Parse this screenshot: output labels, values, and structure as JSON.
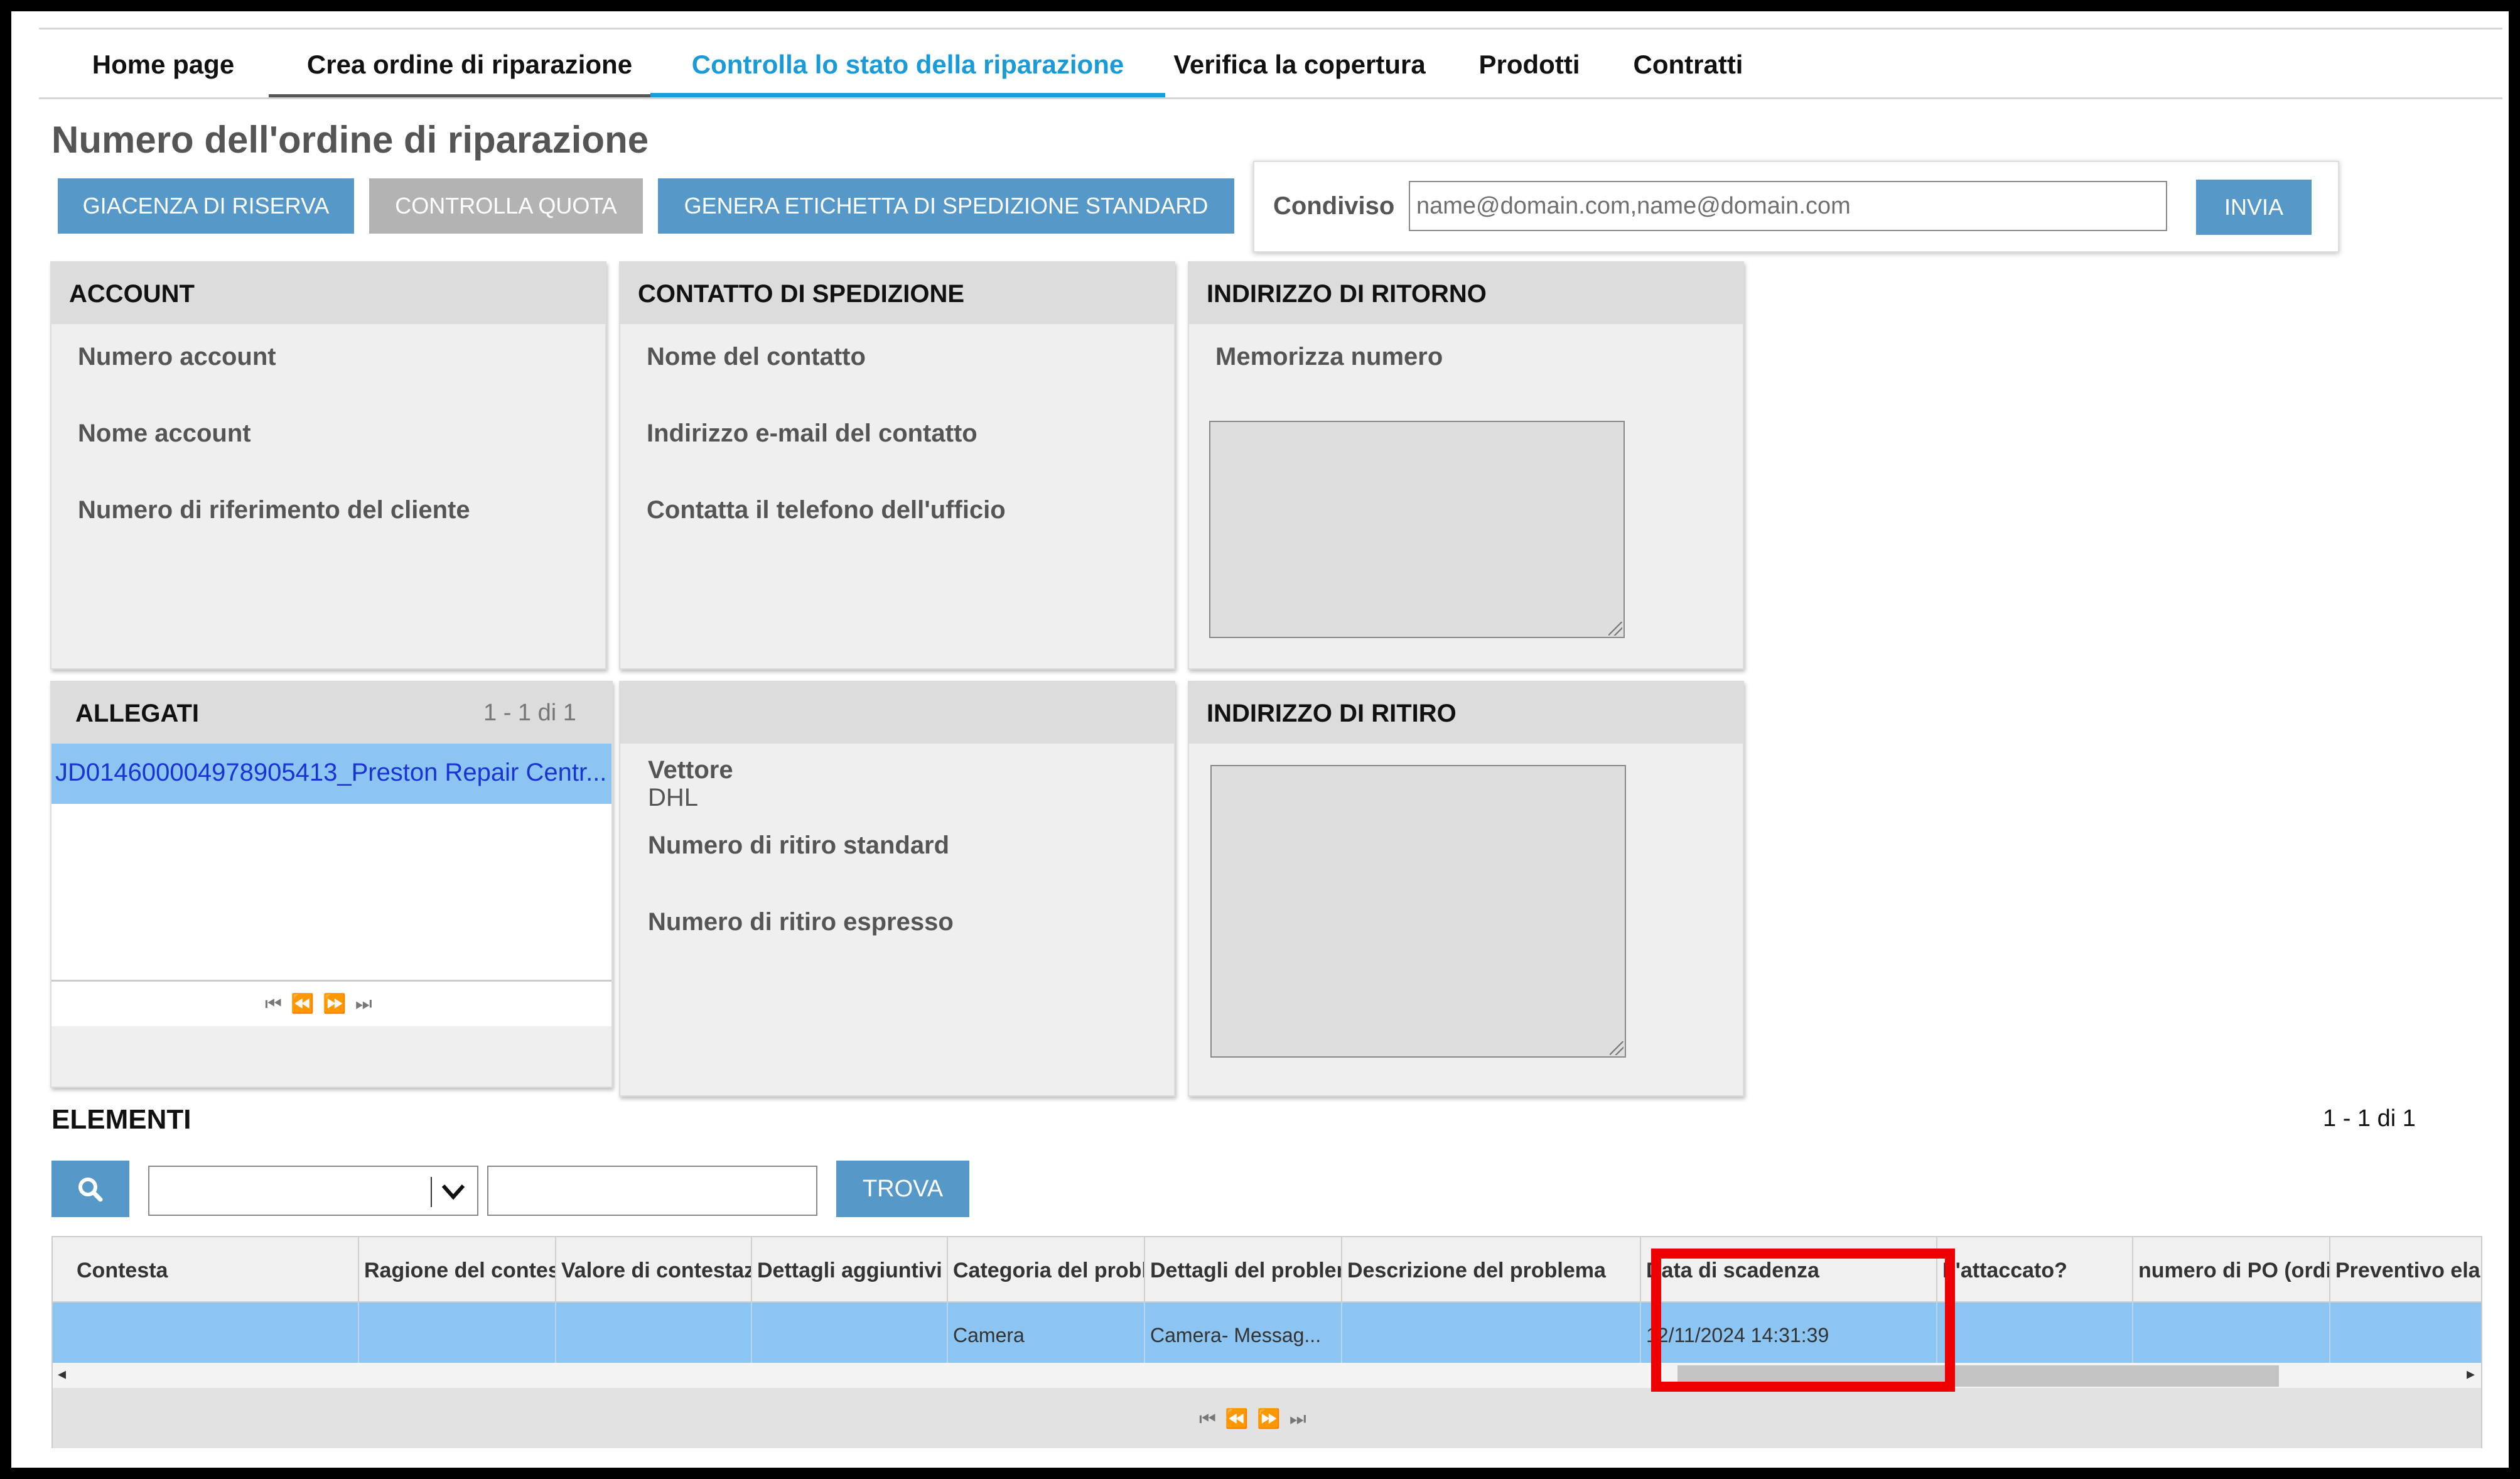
{
  "nav": {
    "tabs": [
      {
        "label": "Home page"
      },
      {
        "label": "Crea ordine di riparazione"
      },
      {
        "label": "Controlla lo stato della riparazione"
      },
      {
        "label": "Verifica la copertura"
      },
      {
        "label": "Prodotti"
      },
      {
        "label": "Contratti"
      }
    ],
    "active_tab": "Controlla lo stato della riparazione"
  },
  "page_title": "Numero dell'ordine di riparazione",
  "actions": {
    "reserve_label": "GIACENZA DI RISERVA",
    "quota_label": "CONTROLLA QUOTA",
    "label_label": "GENERA ETICHETTA DI SPEDIZIONE STANDARD"
  },
  "share": {
    "label": "Condiviso",
    "placeholder": "name@domain.com,name@domain.com",
    "send_label": "INVIA"
  },
  "account": {
    "title": "ACCOUNT",
    "fields": [
      "Numero account",
      "Nome account",
      "Numero di riferimento del cliente"
    ]
  },
  "shipping_contact": {
    "title": "CONTATTO DI SPEDIZIONE",
    "fields": [
      "Nome del contatto",
      "Indirizzo e-mail del contatto",
      "Contatta il telefono dell'ufficio"
    ]
  },
  "return_address": {
    "title": "INDIRIZZO DI RITORNO",
    "store_label": "Memorizza numero"
  },
  "attachments": {
    "title": "ALLEGATI",
    "count": "1 - 1 di 1",
    "items": [
      "JD014600004978905413_Preston Repair Centr..."
    ]
  },
  "carrier": {
    "carrier_label": "Vettore",
    "carrier_value": "DHL",
    "standard_pickup_label": "Numero di ritiro standard",
    "express_pickup_label": "Numero di ritiro espresso"
  },
  "pickup_address": {
    "title": "INDIRIZZO DI RITIRO"
  },
  "elements": {
    "title": "ELEMENTI",
    "count": "1 - 1 di 1",
    "find_label": "TROVA",
    "columns": [
      "Contesta",
      "Ragione del contes",
      "Valore di contestaz",
      "Dettagli aggiuntivi",
      "Categoria del probl",
      "Dettagli del probler",
      "Descrizione del problema",
      "Data di scadenza",
      "L'attaccato?",
      "numero di PO (ordi",
      "Preventivo ela"
    ],
    "rows": [
      [
        "",
        "",
        "",
        "",
        "Camera",
        "Camera- Messag...",
        "",
        "12/11/2024 14:31:39",
        "",
        "",
        ""
      ]
    ]
  },
  "pager_icons": [
    "first-page-icon",
    "prev-page-icon",
    "next-page-icon",
    "last-page-icon"
  ],
  "colors": {
    "accent": "#1a9ad6",
    "button": "#5699c8",
    "button_disabled": "#b3b3b3",
    "selected_row": "#8cc5f2",
    "highlight": "#ee0000"
  }
}
